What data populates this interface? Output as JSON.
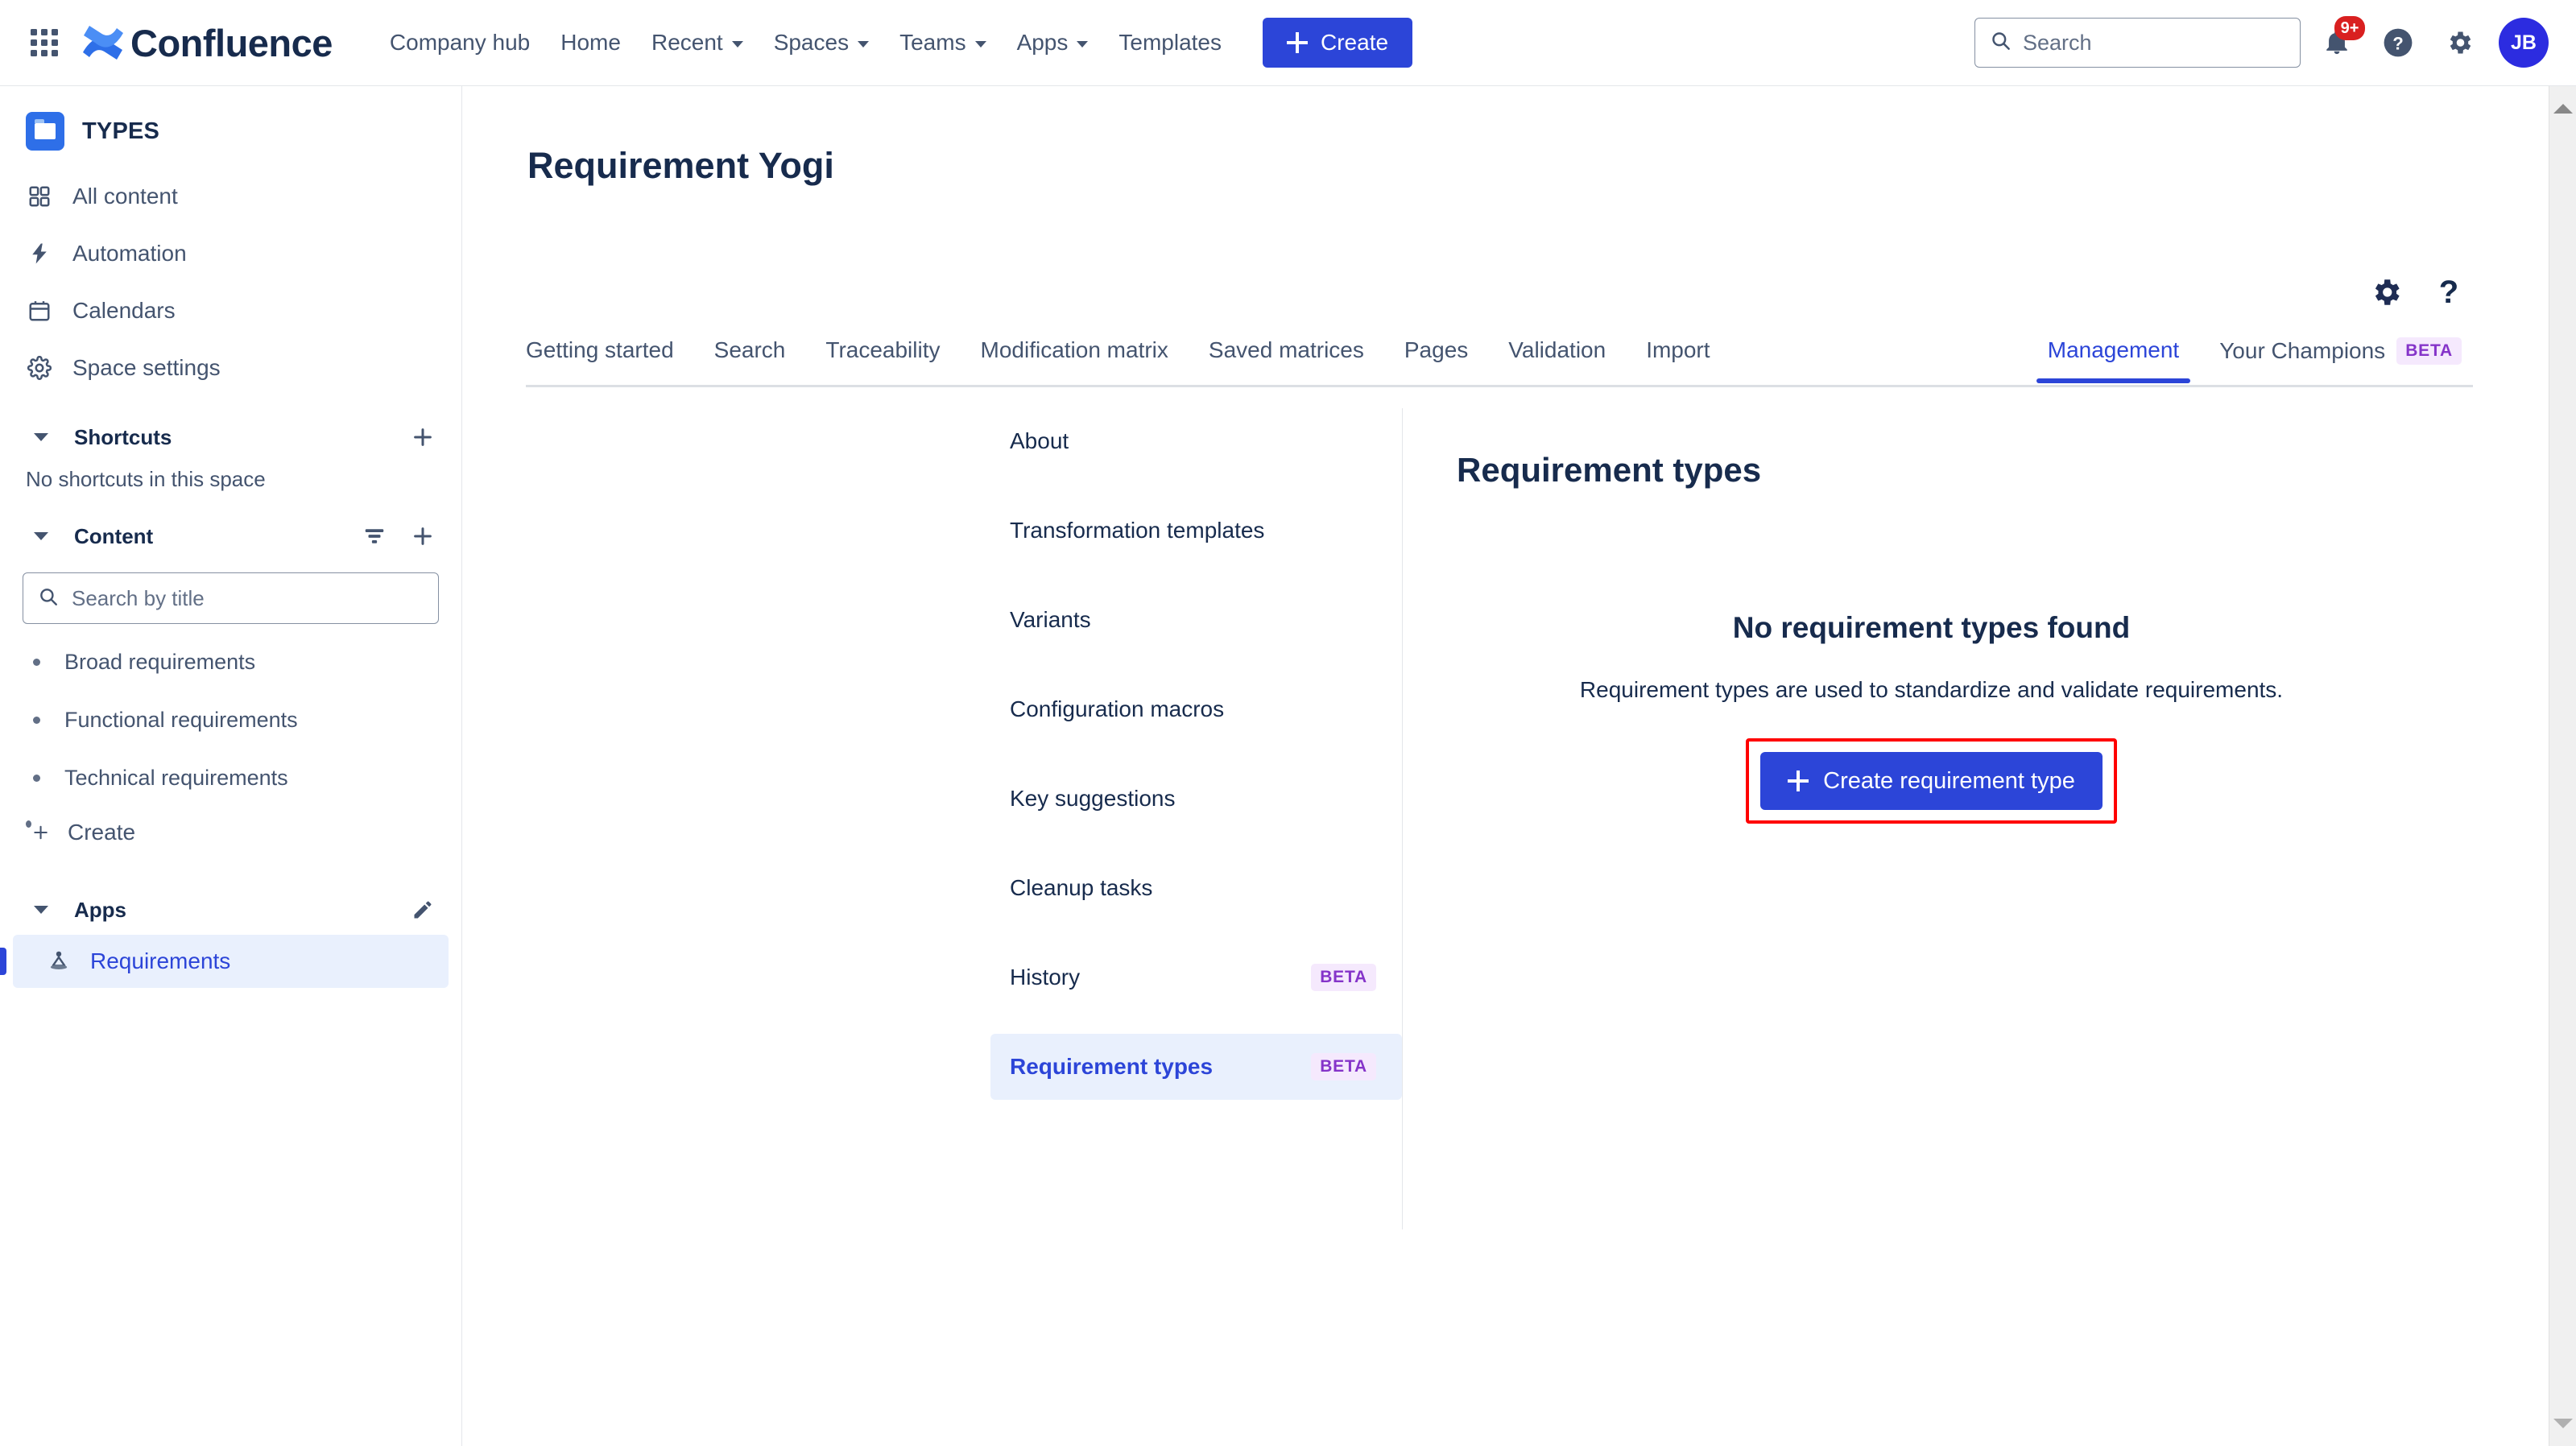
{
  "topnav": {
    "app_switcher_icon": "grid-apps-icon",
    "brand": "Confluence",
    "links": [
      {
        "label": "Company hub",
        "has_caret": false
      },
      {
        "label": "Home",
        "has_caret": false
      },
      {
        "label": "Recent",
        "has_caret": true
      },
      {
        "label": "Spaces",
        "has_caret": true
      },
      {
        "label": "Teams",
        "has_caret": true
      },
      {
        "label": "Apps",
        "has_caret": true
      },
      {
        "label": "Templates",
        "has_caret": false
      }
    ],
    "create_label": "Create",
    "search_placeholder": "Search",
    "search_value": "",
    "notification_badge": "9+",
    "notifications_icon": "bell-icon",
    "help_icon": "question-circle-icon",
    "settings_icon": "gear-icon",
    "avatar_initials": "JB"
  },
  "sidebar": {
    "space_name": "TYPES",
    "space_icon": "folder-icon",
    "nav": [
      {
        "label": "All content",
        "icon": "grid-squares-icon"
      },
      {
        "label": "Automation",
        "icon": "lightning-bolt-icon"
      },
      {
        "label": "Calendars",
        "icon": "calendar-icon"
      },
      {
        "label": "Space settings",
        "icon": "gear-icon"
      }
    ],
    "shortcuts": {
      "title": "Shortcuts",
      "add_icon": "plus-icon",
      "empty_text": "No shortcuts in this space"
    },
    "content": {
      "title": "Content",
      "filter_icon": "filter-icon",
      "add_icon": "plus-icon",
      "search_placeholder": "Search by title",
      "search_value": "",
      "pages": [
        "Broad requirements",
        "Functional requirements",
        "Technical requirements"
      ],
      "create_label": "Create",
      "create_icon": "plus-icon"
    },
    "apps": {
      "title": "Apps",
      "edit_icon": "pencil-icon",
      "items": [
        {
          "label": "Requirements",
          "icon": "yoga-person-icon",
          "selected": true
        }
      ]
    }
  },
  "content": {
    "page_title": "Requirement Yogi",
    "page_actions": [
      {
        "icon": "gear-icon",
        "name": "settings"
      },
      {
        "icon": "question-mark-icon",
        "name": "help"
      }
    ],
    "tabs": [
      {
        "label": "Getting started",
        "active": false,
        "badge": ""
      },
      {
        "label": "Search",
        "active": false,
        "badge": ""
      },
      {
        "label": "Traceability",
        "active": false,
        "badge": ""
      },
      {
        "label": "Modification matrix",
        "active": false,
        "badge": ""
      },
      {
        "label": "Saved matrices",
        "active": false,
        "badge": ""
      },
      {
        "label": "Pages",
        "active": false,
        "badge": ""
      },
      {
        "label": "Validation",
        "active": false,
        "badge": ""
      },
      {
        "label": "Import",
        "active": false,
        "badge": ""
      }
    ],
    "tabs_right": [
      {
        "label": "Management",
        "active": true,
        "badge": ""
      },
      {
        "label": "Your Champions",
        "active": false,
        "badge": "BETA"
      }
    ],
    "inner_nav": [
      {
        "label": "About",
        "badge": "",
        "active": false
      },
      {
        "label": "Transformation templates",
        "badge": "",
        "active": false
      },
      {
        "label": "Variants",
        "badge": "",
        "active": false
      },
      {
        "label": "Configuration macros",
        "badge": "",
        "active": false
      },
      {
        "label": "Key suggestions",
        "badge": "",
        "active": false
      },
      {
        "label": "Cleanup tasks",
        "badge": "",
        "active": false
      },
      {
        "label": "History",
        "badge": "BETA",
        "active": false
      },
      {
        "label": "Requirement types",
        "badge": "BETA",
        "active": true
      }
    ],
    "panel": {
      "title": "Requirement types",
      "empty_title": "No requirement types found",
      "empty_subtitle": "Requirement types are used to standardize and validate requirements.",
      "cta_label": "Create requirement type",
      "cta_icon": "plus-icon",
      "highlight_color": "#ff0000"
    }
  },
  "colors": {
    "brand_blue": "#2c45d8",
    "selected_bg": "#e9f0fd",
    "beta_badge_bg": "#f5e9fd",
    "beta_badge_fg": "#8534c9",
    "text_primary": "#172b4d",
    "text_secondary": "#44546f",
    "notification_red": "#d92020"
  }
}
